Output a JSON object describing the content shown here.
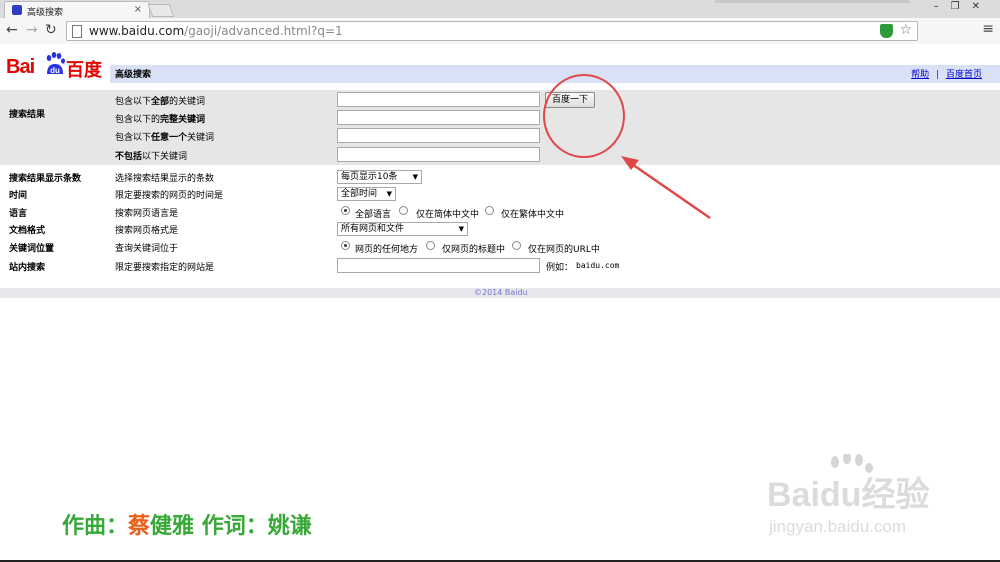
{
  "browser": {
    "tab_title": "高级搜索",
    "url_host": "www.baidu.com",
    "url_path": "/gaoji/advanced.html?q=1"
  },
  "header": {
    "logo_text_latin": "Bai",
    "logo_text_du": "du",
    "logo_text_cn": "百度",
    "title": "高级搜索",
    "help_link": "帮助",
    "separator": "|",
    "home_link": "百度首页"
  },
  "search_results": {
    "section_label": "搜索结果",
    "row1_pre": "包含以下",
    "row1_bold": "全部",
    "row1_post": "的关键词",
    "row2_pre": "包含以下的",
    "row2_bold": "完整关键词",
    "row3_pre": "包含以下",
    "row3_bold": "任意一个",
    "row3_post": "关键词",
    "row4_bold": "不包括",
    "row4_post": "以下关键词",
    "submit_label": "百度一下"
  },
  "options": {
    "count_label": "搜索结果显示条数",
    "count_desc": "选择搜索结果显示的条数",
    "count_value": "每页显示10条",
    "time_label": "时间",
    "time_desc": "限定要搜索的网页的时间是",
    "time_value": "全部时间",
    "lang_label": "语言",
    "lang_desc": "搜索网页语言是",
    "lang_opt1": "全部语言",
    "lang_opt2": "仅在简体中文中",
    "lang_opt3": "仅在繁体中文中",
    "format_label": "文档格式",
    "format_desc": "搜索网页格式是",
    "format_value": "所有网页和文件",
    "pos_label": "关键词位置",
    "pos_desc": "查询关键词位于",
    "pos_opt1": "网页的任何地方",
    "pos_opt2": "仅网页的标题中",
    "pos_opt3": "仅在网页的URL中",
    "site_label": "站内搜索",
    "site_desc": "限定要搜索指定的网站是",
    "site_example_label": "例如：",
    "site_example_value": "baidu.com"
  },
  "footer": {
    "copyright": "©2014 Baidu"
  },
  "caption": {
    "part1": "作曲：",
    "part2": "蔡",
    "part3": "健雅 作词：姚谦"
  },
  "watermark": {
    "text": "Baidu经验",
    "url": "jingyan.baidu.com"
  },
  "colors": {
    "brand_red": "#e10602",
    "brand_blue": "#2932e1",
    "annotation_red": "#e04848",
    "caption_green": "#38a838",
    "caption_orange": "#e8601a"
  }
}
